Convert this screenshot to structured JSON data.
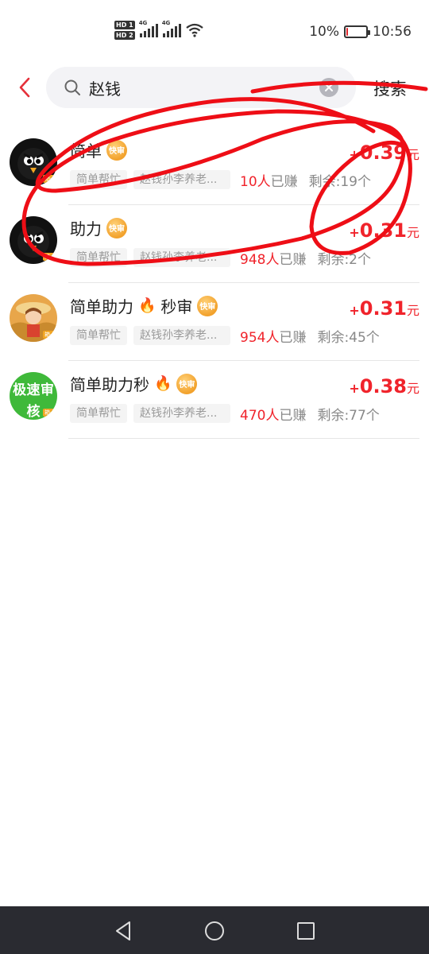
{
  "status_bar": {
    "hd1": "HD 1",
    "hd2": "HD 2",
    "net1": "4G",
    "net2": "4G",
    "battery_percent": "10%",
    "battery_level": 0.1,
    "time": "10:56"
  },
  "search": {
    "query": "赵钱",
    "search_label": "搜索",
    "back_icon": "chevron-left-icon",
    "search_icon": "magnifier-icon",
    "clear_icon": "clear-x-icon"
  },
  "badge_label": "快审",
  "tasks": [
    {
      "title": "简单",
      "has_fire": false,
      "price_prefix": "+",
      "price": "0.39",
      "price_unit": "元",
      "tag1": "简单帮忙",
      "tag2": "赵钱孙李养老...",
      "earned_count": "10人",
      "earned_label": "已赚",
      "remaining": "剩余:19个",
      "avatar_badge": "箱卡"
    },
    {
      "title": "助力",
      "has_fire": false,
      "price_prefix": "+",
      "price": "0.31",
      "price_unit": "元",
      "tag1": "简单帮忙",
      "tag2": "赵钱孙李养老...",
      "earned_count": "948人",
      "earned_label": "已赚",
      "remaining": "剩余:2个",
      "avatar_badge": "箱卡"
    },
    {
      "title": "简单助力",
      "title_suffix": "秒审",
      "has_fire": true,
      "price_prefix": "+",
      "price": "0.31",
      "price_unit": "元",
      "tag1": "简单帮忙",
      "tag2": "赵钱孙李养老...",
      "earned_count": "954人",
      "earned_label": "已赚",
      "remaining": "剩余:45个",
      "avatar_badge": "箱卡"
    },
    {
      "title": "简单助力秒",
      "has_fire": true,
      "price_prefix": "+",
      "price": "0.38",
      "price_unit": "元",
      "tag1": "简单帮忙",
      "tag2": "赵钱孙李养老...",
      "earned_count": "470人",
      "earned_label": "已赚",
      "remaining": "剩余:77个",
      "avatar_text": [
        "极",
        "速",
        "审",
        "核"
      ],
      "avatar_badge": "箱卡"
    }
  ],
  "nav": {
    "back_icon": "triangle-back-icon",
    "home_icon": "circle-home-icon",
    "recents_icon": "square-recents-icon"
  },
  "colors": {
    "accent_red": "#f0232b",
    "badge_orange": "#f2a12b",
    "nav_bg": "#2a2b31"
  }
}
